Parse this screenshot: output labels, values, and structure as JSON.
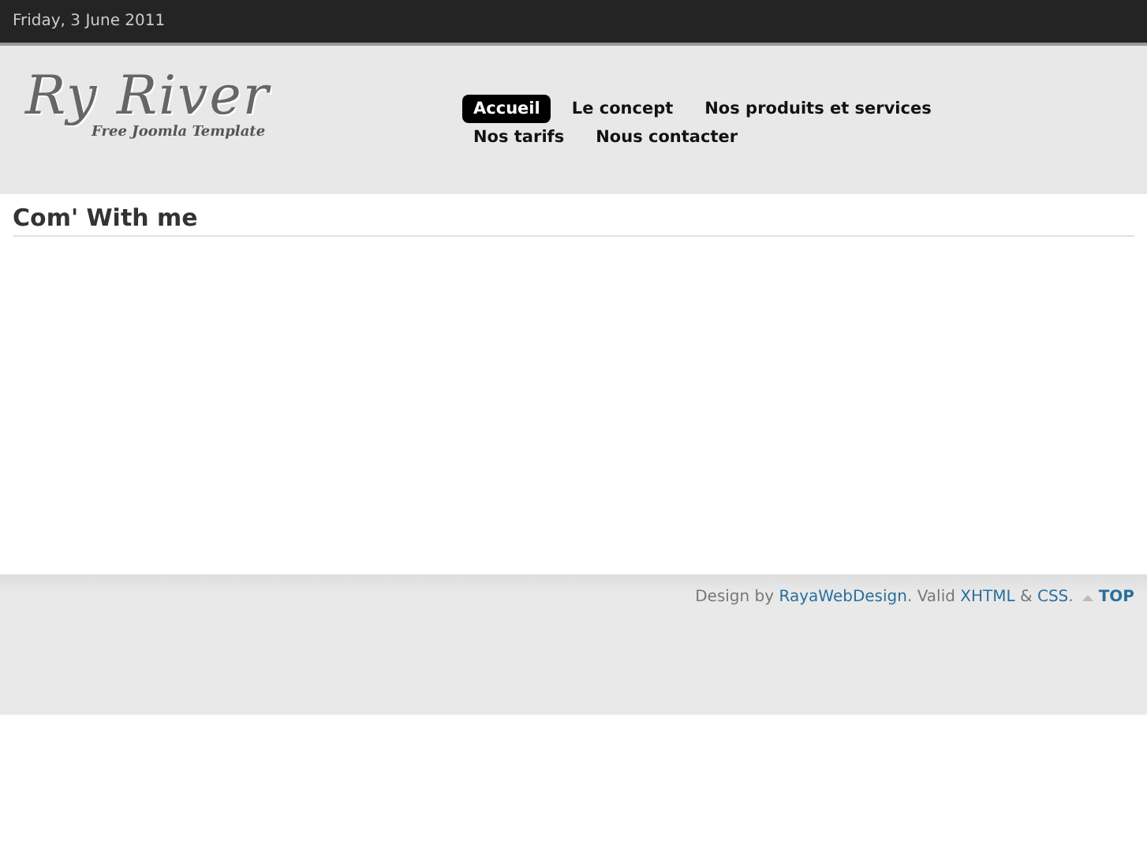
{
  "top_bar": {
    "date": "Friday, 3 June 2011"
  },
  "logo": {
    "title": "Ry River",
    "tagline": "Free Joomla Template"
  },
  "nav": [
    {
      "label": "Accueil",
      "selected": true
    },
    {
      "label": "Le concept",
      "selected": false
    },
    {
      "label": "Nos produits et services",
      "selected": false
    },
    {
      "label": "Nos tarifs",
      "selected": false
    },
    {
      "label": "Nous contacter",
      "selected": false
    }
  ],
  "content": {
    "heading": "Com' With me"
  },
  "footer": {
    "credit": [
      {
        "kind": "text",
        "text": "Design by "
      },
      {
        "kind": "link",
        "text": "RayaWebDesign"
      },
      {
        "kind": "text",
        "text": ". Valid "
      },
      {
        "kind": "link",
        "text": "XHTML"
      },
      {
        "kind": "text",
        "text": " & "
      },
      {
        "kind": "link",
        "text": "CSS"
      },
      {
        "kind": "text",
        "text": "."
      }
    ],
    "top_link": "TOP"
  }
}
